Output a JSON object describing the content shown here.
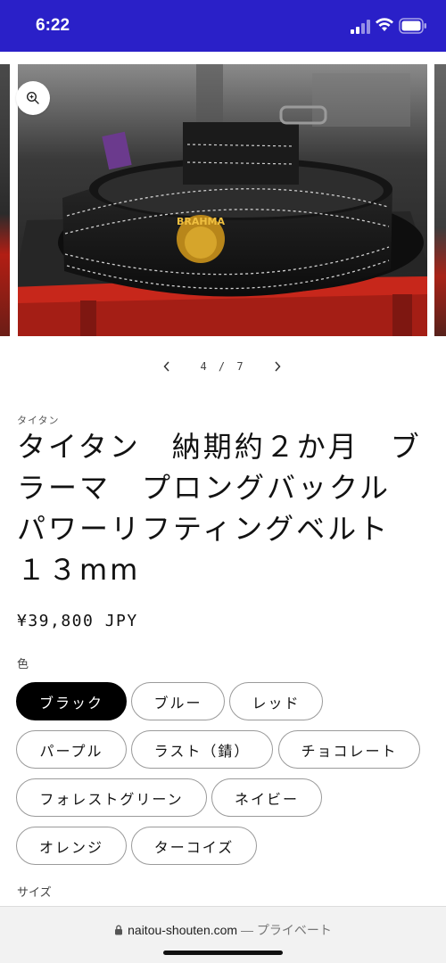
{
  "status_bar": {
    "time": "6:22"
  },
  "gallery": {
    "zoom_icon": "zoom-in-icon",
    "pager": {
      "current": 4,
      "total": 7,
      "text": "4 / 7"
    },
    "photo_caption_text": "BRAHMA"
  },
  "product": {
    "vendor": "タイタン",
    "title": "タイタン　納期約２か月　ブラーマ　プロングバックル　パワーリフティングベルト　１３mm",
    "price": "¥39,800 JPY",
    "color_label": "色",
    "size_label": "サイズ",
    "colors": [
      {
        "label": "ブラック",
        "selected": true
      },
      {
        "label": "ブルー",
        "selected": false
      },
      {
        "label": "レッド",
        "selected": false
      },
      {
        "label": "パープル",
        "selected": false
      },
      {
        "label": "ラスト（錆）",
        "selected": false
      },
      {
        "label": "チョコレート",
        "selected": false
      },
      {
        "label": "フォレストグリーン",
        "selected": false
      },
      {
        "label": "ネイビー",
        "selected": false
      },
      {
        "label": "オレンジ",
        "selected": false
      },
      {
        "label": "ターコイズ",
        "selected": false
      }
    ]
  },
  "browser": {
    "domain": "naitou-shouten.com",
    "separator": "—",
    "mode": "プライベート"
  },
  "colors": {
    "status_bar": "#2a20c8",
    "selected_pill": "#000000",
    "pill_border": "#9a9a9a"
  }
}
